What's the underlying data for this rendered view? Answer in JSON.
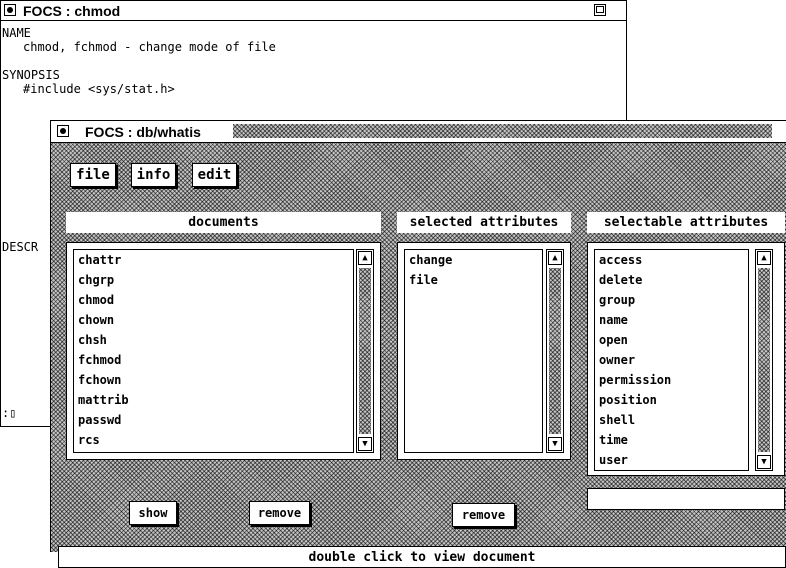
{
  "back_window": {
    "title": "FOCS : chmod",
    "lines": {
      "name_heading": "NAME",
      "name_text": "chmod, fchmod - change mode of file",
      "synopsis_heading": "SYNOPSIS",
      "synopsis_text": "#include <sys/stat.h>",
      "descr_heading": "DESCR",
      "prompt": ":▯"
    }
  },
  "front_window": {
    "title": "FOCS : db/whatis",
    "menu": {
      "file": "file",
      "info": "info",
      "edit": "edit"
    },
    "documents": {
      "header": "documents",
      "items": [
        "chattr",
        "chgrp",
        "chmod",
        "chown",
        "chsh",
        "fchmod",
        "fchown",
        "mattrib",
        "passwd",
        "rcs"
      ]
    },
    "selected_attributes": {
      "header": "selected attributes",
      "items": [
        "change",
        "file"
      ]
    },
    "selectable_attributes": {
      "header": "selectable attributes",
      "items": [
        "access",
        "delete",
        "group",
        "name",
        "open",
        "owner",
        "permission",
        "position",
        "shell",
        "time",
        "user"
      ]
    },
    "buttons": {
      "show": "show",
      "remove_docs": "remove",
      "remove_attrs": "remove"
    },
    "search_field": "",
    "status": "double click to view document"
  },
  "icons": {
    "close": "close-box-icon",
    "zoom": "zoom-box-icon",
    "scroll_up": "▲",
    "scroll_down": "▼"
  }
}
